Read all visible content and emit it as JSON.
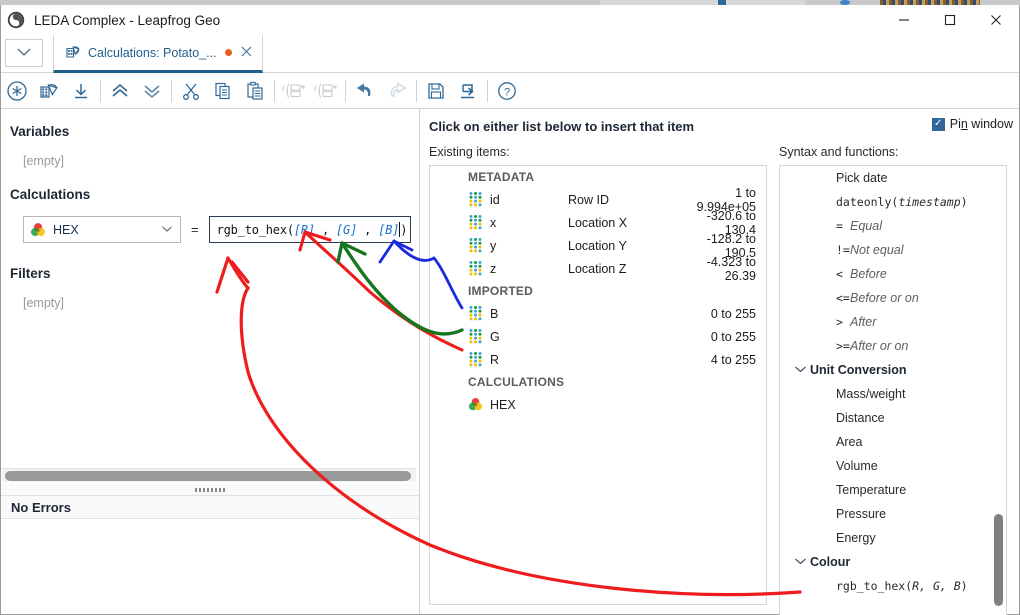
{
  "window": {
    "title": "LEDA Complex - Leapfrog Geo",
    "app_icon": "leapfrog-logo-icon",
    "controls": {
      "minimize": "—",
      "maximize": "□",
      "close": "✕"
    }
  },
  "tabstrip": {
    "dropdown_icon": "chevron-down-icon",
    "tab": {
      "icon": "calculations-table-icon",
      "label": "Calculations: Potato_...",
      "modified_dot": true,
      "close": "✕"
    }
  },
  "toolbar": {
    "buttons": [
      {
        "name": "new-variable-button",
        "icon": "asterisk-circle-icon",
        "disabled": false
      },
      {
        "name": "new-calculation-button",
        "icon": "calc-table-icon",
        "disabled": false
      },
      {
        "name": "import-button",
        "icon": "download-arrow-icon",
        "disabled": false
      },
      {
        "name": "move-up-button",
        "icon": "double-chevron-up-icon",
        "disabled": false
      },
      {
        "name": "move-down-button",
        "icon": "double-chevron-down-icon",
        "disabled": false
      },
      {
        "name": "cut-button",
        "icon": "scissors-icon",
        "disabled": false
      },
      {
        "name": "copy-button",
        "icon": "copy-icon",
        "disabled": false
      },
      {
        "name": "paste-button",
        "icon": "clipboard-paste-icon",
        "disabled": false
      },
      {
        "name": "add-if-branch-button",
        "icon": "if-add-icon",
        "disabled": true
      },
      {
        "name": "remove-if-branch-button",
        "icon": "if-remove-icon",
        "disabled": true
      },
      {
        "name": "undo-button",
        "icon": "undo-arrow-icon",
        "disabled": false
      },
      {
        "name": "redo-button",
        "icon": "redo-arrow-icon",
        "disabled": true
      },
      {
        "name": "save-button",
        "icon": "floppy-disk-icon",
        "disabled": false
      },
      {
        "name": "export-button",
        "icon": "export-arrow-icon",
        "disabled": false
      },
      {
        "name": "help-button",
        "icon": "question-circle-icon",
        "disabled": false
      }
    ]
  },
  "left_pane": {
    "variables_heading": "Variables",
    "variables_empty": "[empty]",
    "calculations_heading": "Calculations",
    "calculation": {
      "icon": "colour-wheel-icon",
      "name": "HEX",
      "dropdown_icon": "chevron-down-icon",
      "equals": "=",
      "formula_prefix": "rgb_to_hex(",
      "formula_tokens": [
        "[R]",
        "[G]",
        "[B]"
      ],
      "formula_separator": " , ",
      "formula_suffix": ")",
      "formula_full": "rgb_to_hex([R] , [G] , [B])"
    },
    "filters_heading": "Filters",
    "filters_empty": "[empty]",
    "status": "No Errors"
  },
  "middle_pane": {
    "hint": "Click on either list below to insert that item",
    "list_label": "Existing items:",
    "groups": [
      {
        "name": "METADATA",
        "items": [
          {
            "icon": "data-dots-icon",
            "name": "id",
            "description": "Row ID",
            "range": "1 to 9.994e+05"
          },
          {
            "icon": "data-dots-icon",
            "name": "x",
            "description": "Location X",
            "range": "-320.6 to 130.4"
          },
          {
            "icon": "data-dots-icon",
            "name": "y",
            "description": "Location Y",
            "range": "-128.2 to 190.5"
          },
          {
            "icon": "data-dots-icon",
            "name": "z",
            "description": "Location Z",
            "range": "-4.323 to 26.39"
          }
        ]
      },
      {
        "name": "IMPORTED",
        "items": [
          {
            "icon": "data-dots-icon",
            "name": "B",
            "description": "",
            "range": "0 to 255"
          },
          {
            "icon": "data-dots-icon",
            "name": "G",
            "description": "",
            "range": "0 to 255"
          },
          {
            "icon": "data-dots-icon",
            "name": "R",
            "description": "",
            "range": "4 to 255"
          }
        ]
      },
      {
        "name": "CALCULATIONS",
        "items": [
          {
            "icon": "colour-wheel-icon",
            "name": "HEX",
            "description": "",
            "range": ""
          }
        ]
      }
    ]
  },
  "right_pane": {
    "pin_label_pre": "Pi",
    "pin_label_accel": "n",
    "pin_label_post": " window",
    "pin_checked": true,
    "list_label": "Syntax and functions:",
    "rows": [
      {
        "kind": "plain",
        "text": "Pick date"
      },
      {
        "kind": "mono",
        "fn": "dateonly(",
        "arg": "timestamp",
        "close": ")"
      },
      {
        "kind": "op",
        "op": "=",
        "meaning": "Equal"
      },
      {
        "kind": "op",
        "op": "!=",
        "meaning": "Not equal"
      },
      {
        "kind": "op",
        "op": "<",
        "meaning": "Before"
      },
      {
        "kind": "op",
        "op": "<=",
        "meaning": "Before or on"
      },
      {
        "kind": "op",
        "op": ">",
        "meaning": "After"
      },
      {
        "kind": "op",
        "op": ">=",
        "meaning": "After or on"
      },
      {
        "kind": "cat",
        "text": "Unit Conversion",
        "expanded": true
      },
      {
        "kind": "plain",
        "text": "Mass/weight"
      },
      {
        "kind": "plain",
        "text": "Distance"
      },
      {
        "kind": "plain",
        "text": "Area"
      },
      {
        "kind": "plain",
        "text": "Volume"
      },
      {
        "kind": "plain",
        "text": "Temperature"
      },
      {
        "kind": "plain",
        "text": "Pressure"
      },
      {
        "kind": "plain",
        "text": "Energy"
      },
      {
        "kind": "cat",
        "text": "Colour",
        "expanded": true
      },
      {
        "kind": "mono",
        "fn": "rgb_to_hex(",
        "arg": "R, G, B",
        "close": ")"
      }
    ]
  },
  "annotations": {
    "colors": {
      "red": "#ee1c1c",
      "green": "#15761f",
      "blue": "#1b2ae0"
    },
    "strokes": [
      {
        "name": "red-arrow-to-R",
        "color": "#ee1c1c",
        "from": "formula-[R]",
        "to": "list-item-R"
      },
      {
        "name": "green-arrow-to-G",
        "color": "#15761f",
        "from": "formula-[G]",
        "to": "list-item-G"
      },
      {
        "name": "blue-arrow-to-B",
        "color": "#1b2ae0",
        "from": "formula-[B]",
        "to": "list-item-B"
      },
      {
        "name": "red-curve-to-rgb-to-hex",
        "color": "#ee1c1c",
        "from": "formula-rgb_to_hex",
        "to": "syntax-rgb_to_hex"
      }
    ]
  }
}
